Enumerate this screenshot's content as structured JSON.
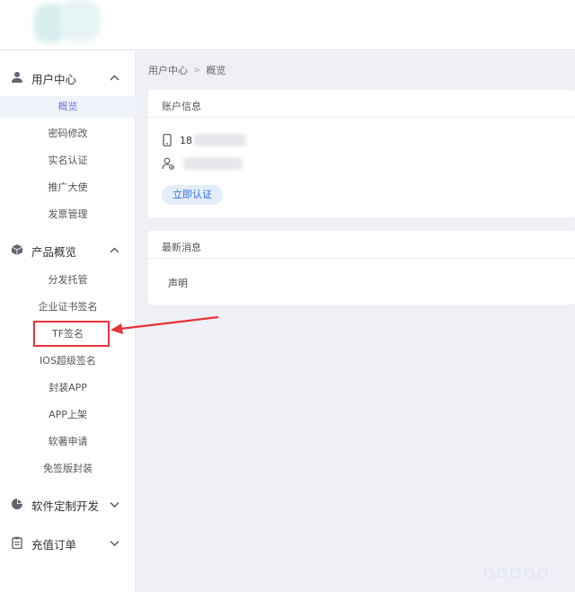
{
  "sidebar": {
    "groups": [
      {
        "label": "用户中心",
        "icon": "user-icon",
        "expanded": true,
        "items": [
          "概览",
          "密码修改",
          "实名认证",
          "推广大使",
          "发票管理"
        ],
        "active_index": 0
      },
      {
        "label": "产品概览",
        "icon": "cube-icon",
        "expanded": true,
        "items": [
          "分发托管",
          "企业证书签名",
          "TF签名",
          "IOS超级签名",
          "封装APP",
          "APP上架",
          "软著申请",
          "免签版封装"
        ]
      },
      {
        "label": "软件定制开发",
        "icon": "pie-chart-icon",
        "expanded": false,
        "items": []
      },
      {
        "label": "充值订单",
        "icon": "clipboard-icon",
        "expanded": false,
        "items": []
      }
    ]
  },
  "breadcrumb": {
    "root": "用户中心",
    "current": "概览"
  },
  "account_card": {
    "title": "账户信息",
    "phone_prefix": "18",
    "verify_button": "立即认证"
  },
  "news_card": {
    "title": "最新消息",
    "entry": "声明"
  },
  "colors": {
    "annotation_red": "#e8333a",
    "active_item_text": "#6c7ae0",
    "verify_button_text": "#2f6fd6",
    "main_background": "#eef0f6"
  }
}
